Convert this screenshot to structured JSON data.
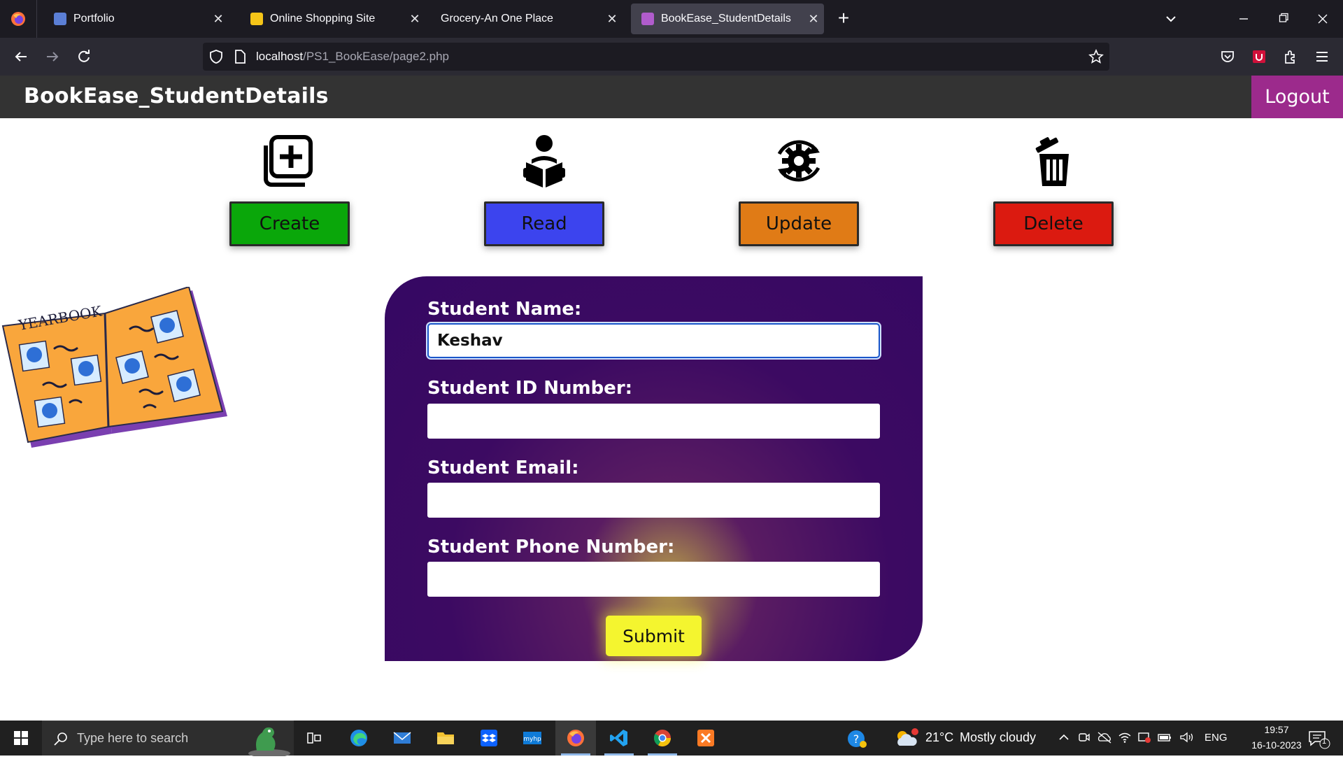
{
  "browser": {
    "tabs": [
      {
        "label": "Portfolio",
        "favicon_color": "#5b7fd6"
      },
      {
        "label": "Online Shopping Site",
        "favicon_color": "#f5c518"
      },
      {
        "label": "Grocery-An One Place",
        "favicon_color": ""
      },
      {
        "label": "BookEase_StudentDetails",
        "favicon_color": "#b05ccc"
      }
    ],
    "close_glyph": "✕",
    "new_tab_glyph": "+",
    "url_host": "localhost",
    "url_path": "/PS1_BookEase/page2.php"
  },
  "app": {
    "title": "BookEase_StudentDetails",
    "logout_label": "Logout",
    "actions": [
      {
        "label": "Create",
        "color": "#0aa70a",
        "icon": "add-square-icon"
      },
      {
        "label": "Read",
        "color": "#3c44ee",
        "icon": "reader-icon"
      },
      {
        "label": "Update",
        "color": "#e07b16",
        "icon": "gear-sync-icon"
      },
      {
        "label": "Delete",
        "color": "#db1a10",
        "icon": "trash-icon"
      }
    ]
  },
  "form": {
    "fields": [
      {
        "label": "Student Name:",
        "value": "Keshav"
      },
      {
        "label": "Student ID Number:",
        "value": ""
      },
      {
        "label": "Student Email:",
        "value": ""
      },
      {
        "label": "Student Phone Number:",
        "value": ""
      }
    ],
    "submit_label": "Submit"
  },
  "taskbar": {
    "search_placeholder": "Type here to search",
    "weather_temp": "21°C",
    "weather_text": "Mostly cloudy",
    "language": "ENG",
    "time": "19:57",
    "date": "16-10-2023",
    "notification_count": "1"
  }
}
